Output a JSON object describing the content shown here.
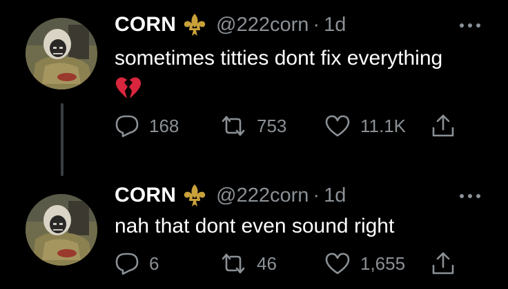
{
  "tweets": [
    {
      "author": {
        "display_name": "CORN",
        "handle": "@222corn",
        "badge_icon": "fleur-de-lis-icon",
        "avatar": "hooded-figure-avatar"
      },
      "separator": "·",
      "time": "1d",
      "text": "sometimes titties dont fix everything",
      "emoji": "broken-heart",
      "counts": {
        "replies": "168",
        "retweets": "753",
        "likes": "11.1K"
      }
    },
    {
      "author": {
        "display_name": "CORN",
        "handle": "@222corn",
        "badge_icon": "fleur-de-lis-icon",
        "avatar": "hooded-figure-avatar"
      },
      "separator": "·",
      "time": "1d",
      "text": "nah that dont even sound right",
      "counts": {
        "replies": "6",
        "retweets": "46",
        "likes": "1,655"
      }
    }
  ],
  "colors": {
    "background": "#000000",
    "primary_text": "#ffffff",
    "secondary_text": "#8b9196",
    "thread_line": "#3a3d40",
    "badge_gold": "#c9a13a",
    "broken_heart": "#d7263d"
  }
}
